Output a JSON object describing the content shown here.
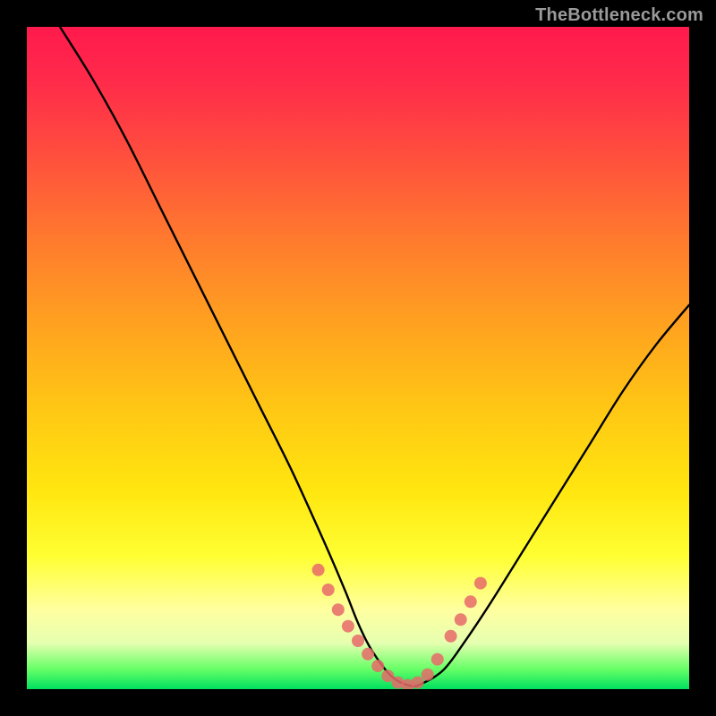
{
  "watermark": "TheBottleneck.com",
  "chart_data": {
    "type": "line",
    "title": "",
    "xlabel": "",
    "ylabel": "",
    "xlim": [
      0,
      100
    ],
    "ylim": [
      0,
      100
    ],
    "grid": false,
    "legend": false,
    "notes": "Axes and tick labels are not rendered in the image; values are normalized 0–100. Curve is a V-shaped bottleneck curve with minimum near x≈55, y≈0. Pink dotted markers overlay the curve in the bottom ~18% (low-bottleneck region).",
    "series": [
      {
        "name": "bottleneck-curve",
        "color": "#000000",
        "x": [
          5,
          10,
          15,
          20,
          25,
          30,
          35,
          40,
          45,
          48,
          50,
          52,
          55,
          58,
          60,
          63,
          66,
          70,
          75,
          80,
          85,
          90,
          95,
          100
        ],
        "y": [
          100,
          92,
          83,
          73,
          63,
          53,
          43,
          33,
          22,
          15,
          10,
          6,
          2,
          0.5,
          1,
          3,
          7,
          13,
          21,
          29,
          37,
          45,
          52,
          58
        ]
      },
      {
        "name": "low-bottleneck-markers",
        "color": "#e86a6a",
        "marker": "dot",
        "x": [
          44,
          45.5,
          47,
          48.5,
          50,
          51.5,
          53,
          54.5,
          56,
          57.5,
          59,
          60.5,
          62,
          64,
          65.5,
          67,
          68.5
        ],
        "y": [
          18,
          15,
          12,
          9.5,
          7.3,
          5.3,
          3.5,
          2,
          1,
          0.6,
          1,
          2.2,
          4.5,
          8,
          10.5,
          13.2,
          16
        ]
      }
    ]
  }
}
